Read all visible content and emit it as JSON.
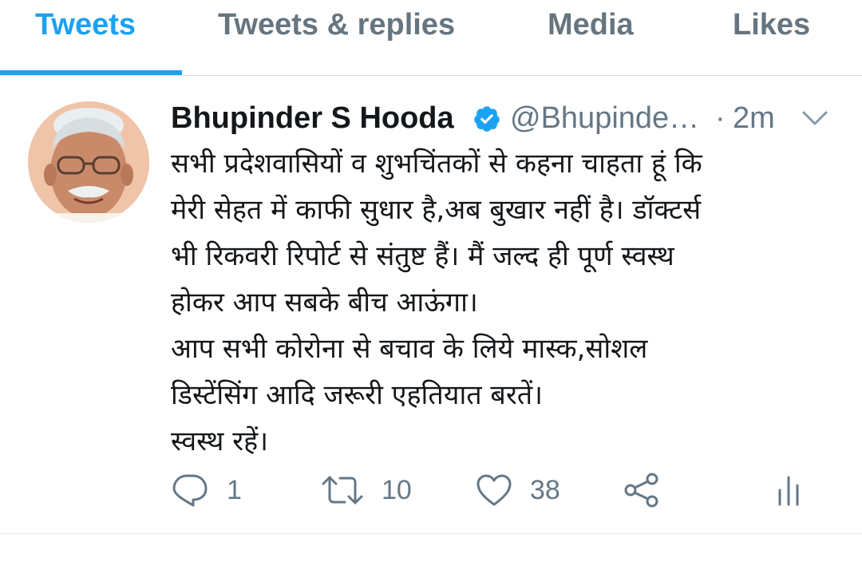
{
  "tabs": [
    {
      "label": "Tweets",
      "active": true
    },
    {
      "label": "Tweets & replies",
      "active": false
    },
    {
      "label": "Media",
      "active": false
    },
    {
      "label": "Likes",
      "active": false
    }
  ],
  "tweet": {
    "author_name": "Bhupinder S Hooda",
    "verified": true,
    "handle": "@Bhupinde…",
    "separator": "·",
    "time": "2m",
    "lines": [
      "सभी प्रदेशवासियों व शुभचिंतकों से कहना चाहता हूं कि",
      "मेरी सेहत में काफी सुधार है,अब बुखार नहीं है। डॉक्टर्स",
      "भी रिकवरी रिपोर्ट से संतुष्ट हैं। मैं जल्द ही पूर्ण स्वस्थ",
      "होकर आप सबके बीच आऊंगा।",
      "आप सभी कोरोना से बचाव के लिये मास्क,सोशल",
      "डिस्टेंसिंग आदि जरूरी एहतियात बरतें।",
      "स्वस्थ रहें।"
    ],
    "actions": {
      "reply_count": "1",
      "retweet_count": "10",
      "like_count": "38"
    }
  },
  "icons": {
    "verified": "verified-badge-icon",
    "caret": "chevron-down-icon",
    "reply": "reply-icon",
    "retweet": "retweet-icon",
    "like": "heart-icon",
    "share": "share-icon",
    "analytics": "analytics-icon"
  },
  "colors": {
    "accent": "#1da1f2",
    "text_primary": "#14171a",
    "text_secondary": "#657786",
    "tab_inactive": "#66757f"
  }
}
